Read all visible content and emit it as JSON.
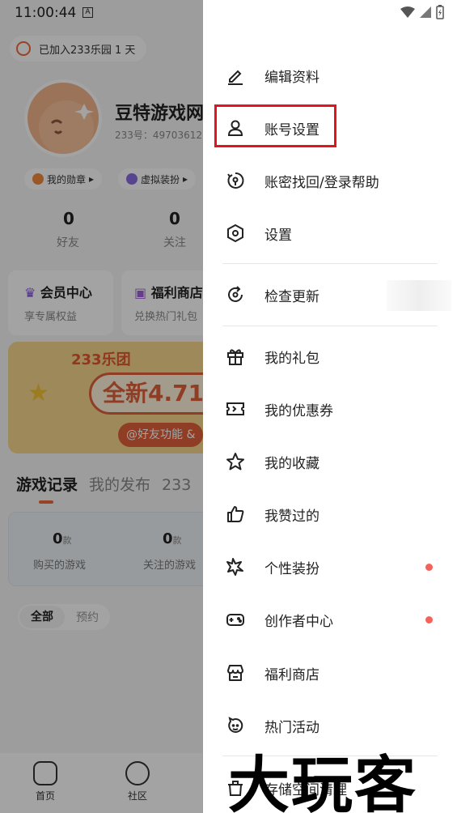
{
  "status": {
    "time": "11:00:44",
    "notif_glyph": "A"
  },
  "background": {
    "joined_text": "已加入233乐园 1 天",
    "username": "豆特游戏网",
    "user_id": "233号：49703612",
    "chips": [
      "我的勋章",
      "虚拟装扮"
    ],
    "stats": [
      {
        "num": "0",
        "label": "好友"
      },
      {
        "num": "0",
        "label": "关注"
      }
    ],
    "cards": [
      {
        "title": "会员中心",
        "sub": "享专属权益"
      },
      {
        "title": "福利商店",
        "sub": "兑换热门礼包"
      }
    ],
    "banner": {
      "brand": "233乐团",
      "headline": "全新4.71",
      "tag": "@好友功能 &"
    },
    "tabs": [
      "游戏记录",
      "我的发布",
      "233"
    ],
    "records": [
      {
        "num": "0",
        "unit": "款",
        "label": "购买的游戏"
      },
      {
        "num": "0",
        "unit": "款",
        "label": "关注的游戏"
      }
    ],
    "filters": [
      "全部",
      "预约"
    ],
    "bottom_nav": [
      "首页",
      "社区"
    ]
  },
  "drawer": {
    "items": [
      {
        "label": "编辑资料",
        "icon": "pencil-icon"
      },
      {
        "label": "账号设置",
        "icon": "person-icon"
      },
      {
        "label": "账密找回/登录帮助",
        "icon": "key-help-icon"
      },
      {
        "label": "设置",
        "icon": "hexagon-settings-icon"
      },
      {
        "label": "检查更新",
        "icon": "refresh-icon"
      },
      {
        "label": "我的礼包",
        "icon": "gift-icon"
      },
      {
        "label": "我的优惠券",
        "icon": "ticket-icon"
      },
      {
        "label": "我的收藏",
        "icon": "star-icon"
      },
      {
        "label": "我赞过的",
        "icon": "thumbs-up-icon"
      },
      {
        "label": "个性装扮",
        "icon": "sparkle-icon",
        "badge": true
      },
      {
        "label": "创作者中心",
        "icon": "gamepad-icon",
        "badge": true
      },
      {
        "label": "福利商店",
        "icon": "shop-icon"
      },
      {
        "label": "热门活动",
        "icon": "smile-icon"
      },
      {
        "label": "存储空间清理",
        "icon": "trash-icon"
      }
    ],
    "highlight_color": "#e3141b",
    "badge_color": "#f4625a"
  },
  "watermark": "大玩客"
}
